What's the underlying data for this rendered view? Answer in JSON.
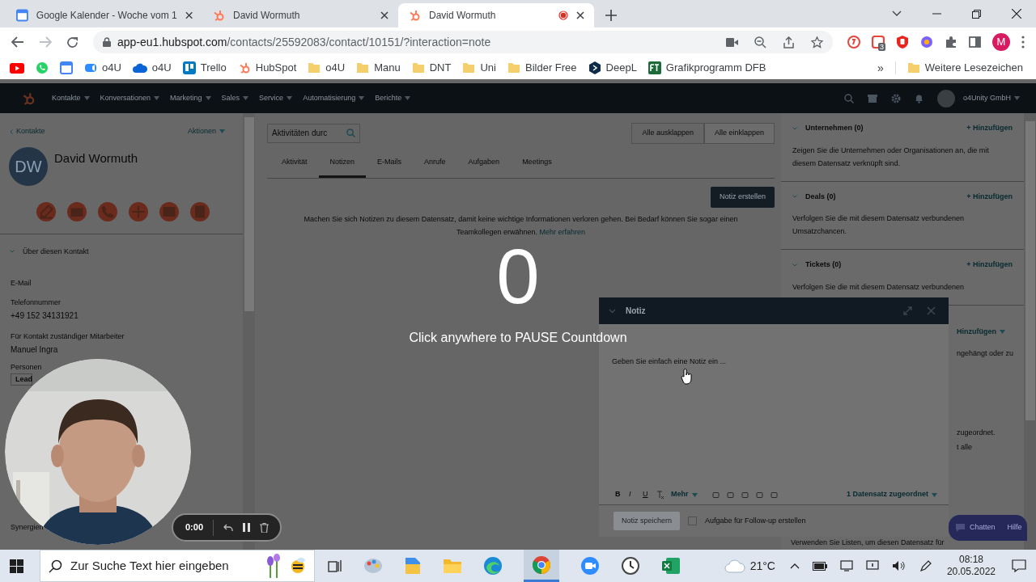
{
  "browser": {
    "tabs": [
      {
        "title": "Google Kalender - Woche vom 1",
        "selected": false,
        "recording": false
      },
      {
        "title": "David Wormuth",
        "selected": false,
        "recording": false
      },
      {
        "title": "David Wormuth",
        "selected": true,
        "recording": true
      }
    ],
    "url_host": "app-eu1.hubspot.com",
    "url_path": "/contacts/25592083/contact/10151/?interaction=note",
    "extension_badge": "3",
    "profile_initial": "M",
    "bookmarks": [
      "o4U",
      "o4U",
      "Trello",
      "HubSpot",
      "o4U",
      "Manu",
      "DNT",
      "Uni",
      "Bilder Free",
      "DeepL",
      "Grafikprogramm DFB"
    ],
    "bookmarks_more": "»",
    "other_bookmarks": "Weitere Lesezeichen"
  },
  "nav": {
    "items": [
      "Kontakte",
      "Konversationen",
      "Marketing",
      "Sales",
      "Service",
      "Automatisierung",
      "Berichte"
    ],
    "account": "o4Unity GmbH"
  },
  "contact": {
    "back": "Kontakte",
    "actions": "Aktionen",
    "initials": "DW",
    "name": "David Wormuth",
    "section": "Über diesen Kontakt",
    "fields": [
      {
        "label": "E-Mail"
      },
      {
        "label": "Telefonnummer",
        "value": "+49 152 34131921"
      },
      {
        "label": "Für Kontakt zuständiger Mitarbeiter",
        "value": "Manuel Ingra"
      }
    ],
    "covered": {
      "label": "Personen",
      "select": "Lead",
      "next_label": "Synergien"
    }
  },
  "activity": {
    "search_placeholder": "Aktivitäten durc",
    "collapse_buttons": [
      "Alle ausklappen",
      "Alle einklappen"
    ],
    "tabs": [
      {
        "label": "Aktivität",
        "selected": false
      },
      {
        "label": "Notizen",
        "selected": true
      },
      {
        "label": "E-Mails",
        "selected": false
      },
      {
        "label": "Anrufe",
        "selected": false
      },
      {
        "label": "Aufgaben",
        "selected": false
      },
      {
        "label": "Meetings",
        "selected": false
      }
    ],
    "create_button": "Notiz erstellen",
    "empty_text": "Machen Sie sich Notizen zu diesem Datensatz, damit keine wichtige Informationen verloren gehen. Bei Bedarf können Sie sogar einen Teamkollegen erwähnen.",
    "link": "Mehr erfahren"
  },
  "sidebar": {
    "cards": [
      {
        "title": "Unternehmen (0)",
        "add": "+ Hinzufügen",
        "description": "Zeigen Sie die Unternehmen oder Organisationen an, die mit diesem Datensatz verknüpft sind."
      },
      {
        "title": "Deals (0)",
        "add": "+ Hinzufügen",
        "description": "Verfolgen Sie die mit diesem Datensatz verbundenen Umsatzchancen."
      },
      {
        "title": "Tickets (0)",
        "add": "+ Hinzufügen",
        "description": "Verfolgen Sie die mit diesem Datensatz verbundenen"
      }
    ],
    "covered_add": "Hinzufügen",
    "covered_lines": [
      "ngehängt oder zu",
      "zugeordnet.",
      "t alle"
    ],
    "last_line": "Verwenden Sie Listen, um diesen Datensatz für"
  },
  "countdown": {
    "number": "0",
    "hint": "Click anywhere to PAUSE Countdown"
  },
  "note": {
    "title": "Notiz",
    "placeholder": "Geben Sie einfach eine Notiz ein ...",
    "format_buttons": [
      "B",
      "I",
      "U"
    ],
    "more": "Mehr",
    "associations": "1 Datensatz zugeordnet",
    "save": "Notiz speichern",
    "save_disabled": true,
    "followup": {
      "label": "Aufgabe für Follow-up erstellen",
      "checked": false
    }
  },
  "recorder": {
    "time": "0:00"
  },
  "chat": {
    "chat": "Chatten",
    "help": "Hilfe"
  },
  "taskbar": {
    "search_placeholder": "Zur Suche Text hier eingeben",
    "temperature": "21°C",
    "time": "08:18",
    "date": "20.05.2022"
  }
}
